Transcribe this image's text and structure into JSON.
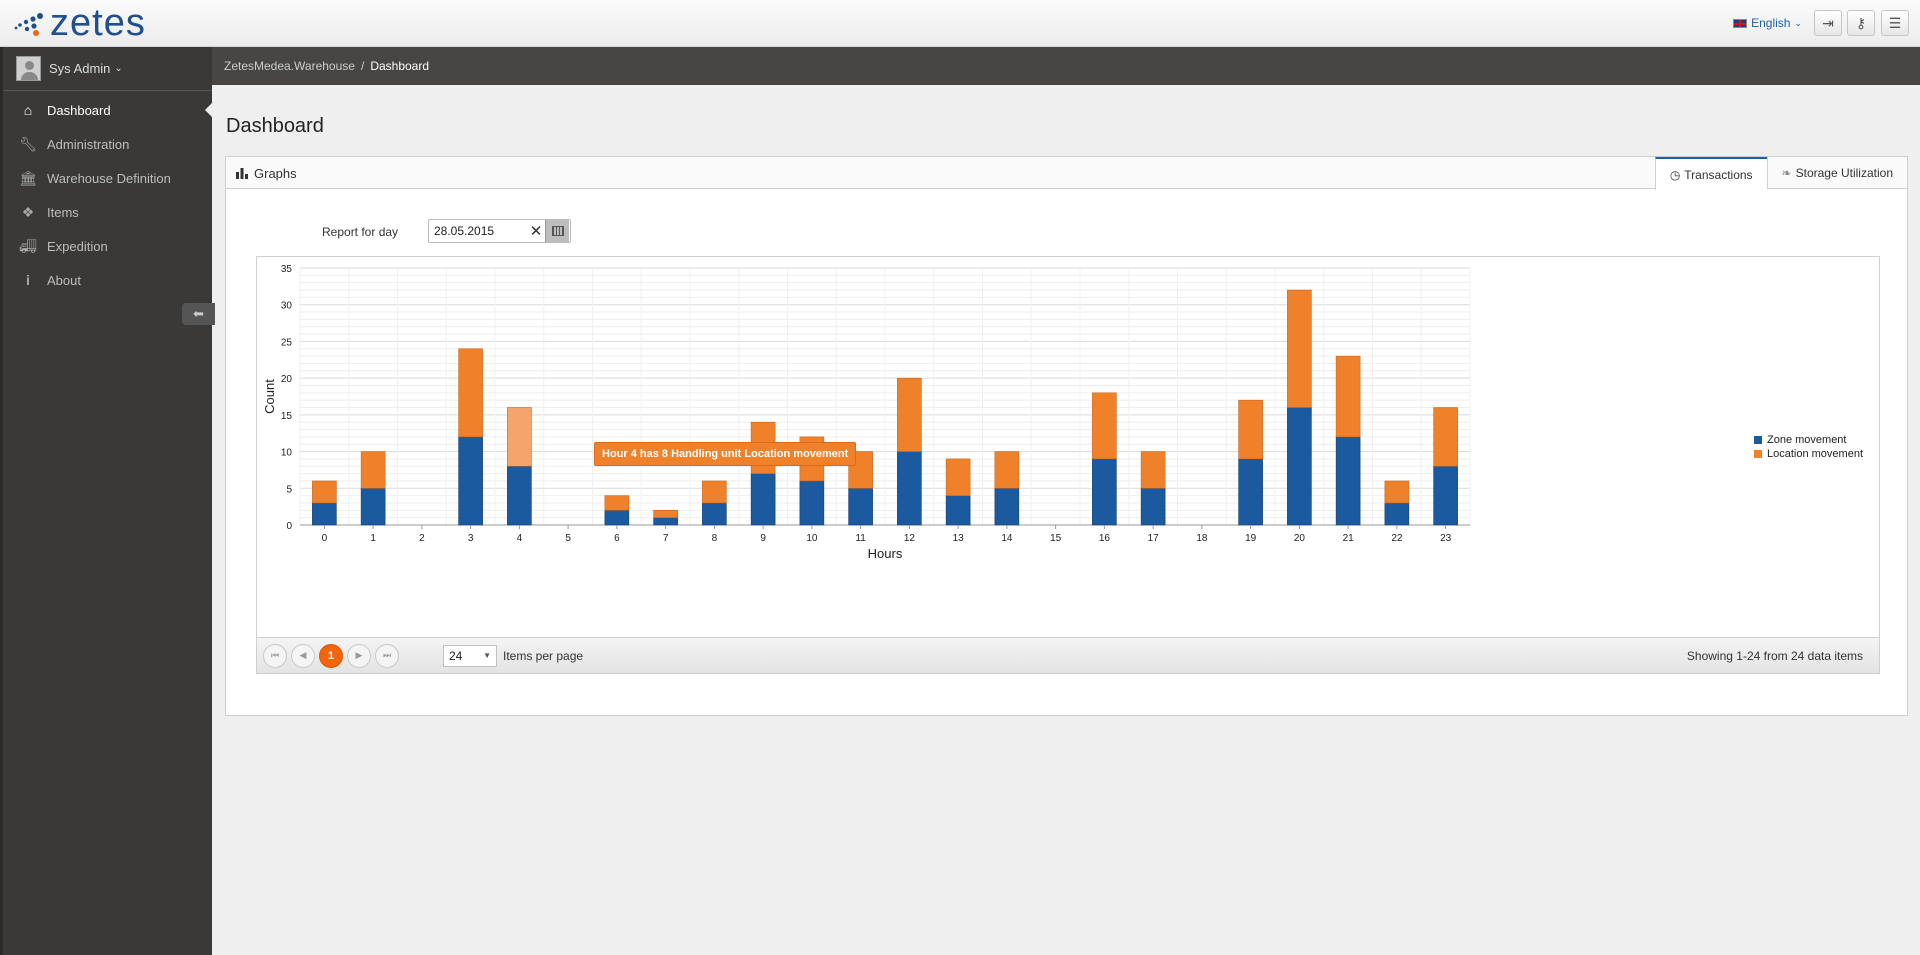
{
  "brand": {
    "logo_text": "zetes"
  },
  "topbar": {
    "language": "English",
    "buttons": [
      "logout-icon",
      "key-icon",
      "menu-icon"
    ]
  },
  "sidebar": {
    "user_name": "Sys Admin",
    "items": [
      {
        "label": "Dashboard",
        "icon": "home-icon",
        "active": true
      },
      {
        "label": "Administration",
        "icon": "wrench-icon"
      },
      {
        "label": "Warehouse Definition",
        "icon": "bank-icon"
      },
      {
        "label": "Items",
        "icon": "dropbox-icon"
      },
      {
        "label": "Expedition",
        "icon": "truck-icon"
      },
      {
        "label": "About",
        "icon": "info-icon"
      }
    ]
  },
  "breadcrumb": {
    "root": "ZetesMedea.Warehouse",
    "sep": "/",
    "current": "Dashboard"
  },
  "page": {
    "title": "Dashboard"
  },
  "panel": {
    "title": "Graphs",
    "tabs": [
      {
        "label": "Transactions",
        "active": true
      },
      {
        "label": "Storage Utilization",
        "active": false
      }
    ],
    "report_label": "Report for day",
    "report_date": "28.05.2015"
  },
  "tooltip": "Hour 4 has 8 Handling unit Location movement",
  "pager": {
    "current_page": "1",
    "page_size": "24",
    "items_per_page_label": "Items per page",
    "info": "Showing 1-24 from 24 data items"
  },
  "colors": {
    "zone": "#1b5a9e",
    "location": "#f0812b",
    "accent": "#f0650e"
  },
  "chart_data": {
    "type": "bar",
    "stacked": true,
    "categories": [
      "0",
      "1",
      "2",
      "3",
      "4",
      "5",
      "6",
      "7",
      "8",
      "9",
      "10",
      "11",
      "12",
      "13",
      "14",
      "15",
      "16",
      "17",
      "18",
      "19",
      "20",
      "21",
      "22",
      "23"
    ],
    "series": [
      {
        "name": "Zone movement",
        "values": [
          3,
          5,
          0,
          12,
          8,
          0,
          2,
          1,
          3,
          7,
          6,
          5,
          10,
          4,
          5,
          0,
          9,
          5,
          0,
          9,
          16,
          12,
          3,
          8
        ]
      },
      {
        "name": "Location movement",
        "values": [
          3,
          5,
          0,
          12,
          8,
          0,
          2,
          1,
          3,
          7,
          6,
          5,
          10,
          5,
          5,
          0,
          9,
          5,
          0,
          8,
          16,
          11,
          3,
          8
        ]
      }
    ],
    "xlabel": "Hours",
    "ylabel": "Count",
    "ylim": [
      0,
      35
    ],
    "yticks": [
      0,
      5,
      10,
      15,
      20,
      25,
      30,
      35
    ],
    "grid": true,
    "legend": "right"
  }
}
